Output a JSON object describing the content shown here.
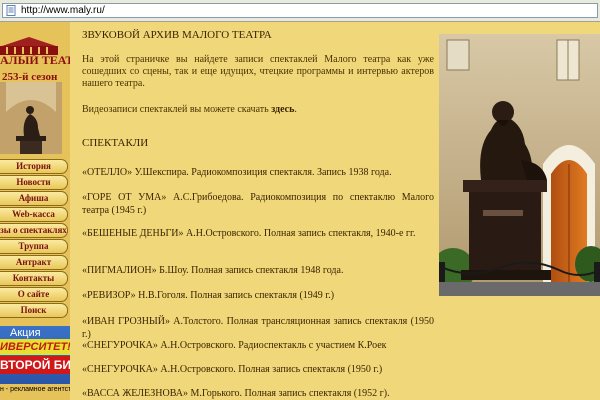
{
  "browser": {
    "url": "http://www.maly.ru/"
  },
  "sidebar": {
    "logo_title": "АЛЫЙ ТЕАТР",
    "season": "253-й сезон",
    "nav": [
      "История",
      "Новости",
      "Афиша",
      "Web-касса",
      "зы о спектаклях",
      "Труппа",
      "Антракт",
      "Контакты",
      "О сайте",
      "Поиск"
    ],
    "promo": {
      "line1": "Акция",
      "line2": "ИВЕРСИТЕТ!",
      "line3": "ВТОРОЙ БИЛЕТ!"
    },
    "footer": "н - рекламное агентство"
  },
  "main": {
    "title": "ЗВУКОВОЙ АРХИВ МАЛОГО ТЕАТРА",
    "intro": "На этой страничке вы найдете записи спектаклей Малого театра как уже сошедших со сцены, так и еще идущих, чтецкие программы и интервью актеров нашего театра.",
    "video_text": "Видеозаписи спектаклей вы можете скачать ",
    "video_link": "здесь",
    "video_end": ".",
    "section": "СПЕКТАКЛИ",
    "records": [
      "«ОТЕЛЛО» У.Шекспира. Радиокомпозиция спектакля. Запись 1938 года.",
      "«ГОРЕ ОТ УМА» А.С.Грибоедова. Радиокомпозиция по спектаклю Малого театра (1945 г.)",
      "«БЕШЕНЫЕ ДЕНЬГИ» А.Н.Островского. Полная запись спектакля, 1940-е гг.",
      "«ПИГМАЛИОН» Б.Шоу. Полная запись спектакля 1948 года.",
      "«РЕВИЗОР» Н.В.Гоголя. Полная запись спектакля (1949 г.)",
      "«ИВАН ГРОЗНЫЙ» А.Толстого. Полная трансляционная запись спектакля (1950 г.)",
      "«СНЕГУРОЧКА» А.Н.Островского. Радиоспектакль с участием К.Роек",
      "«СНЕГУРОЧКА» А.Н.Островского. Полная запись спектакля (1950 г.)",
      "«ВАССА ЖЕЛЕЗНОВА» М.Горького. Полная запись спектакля (1952 г)."
    ]
  },
  "colors": {
    "page_bg": "#f0d77a",
    "text": "#3a2400",
    "accent": "#8a1010"
  }
}
